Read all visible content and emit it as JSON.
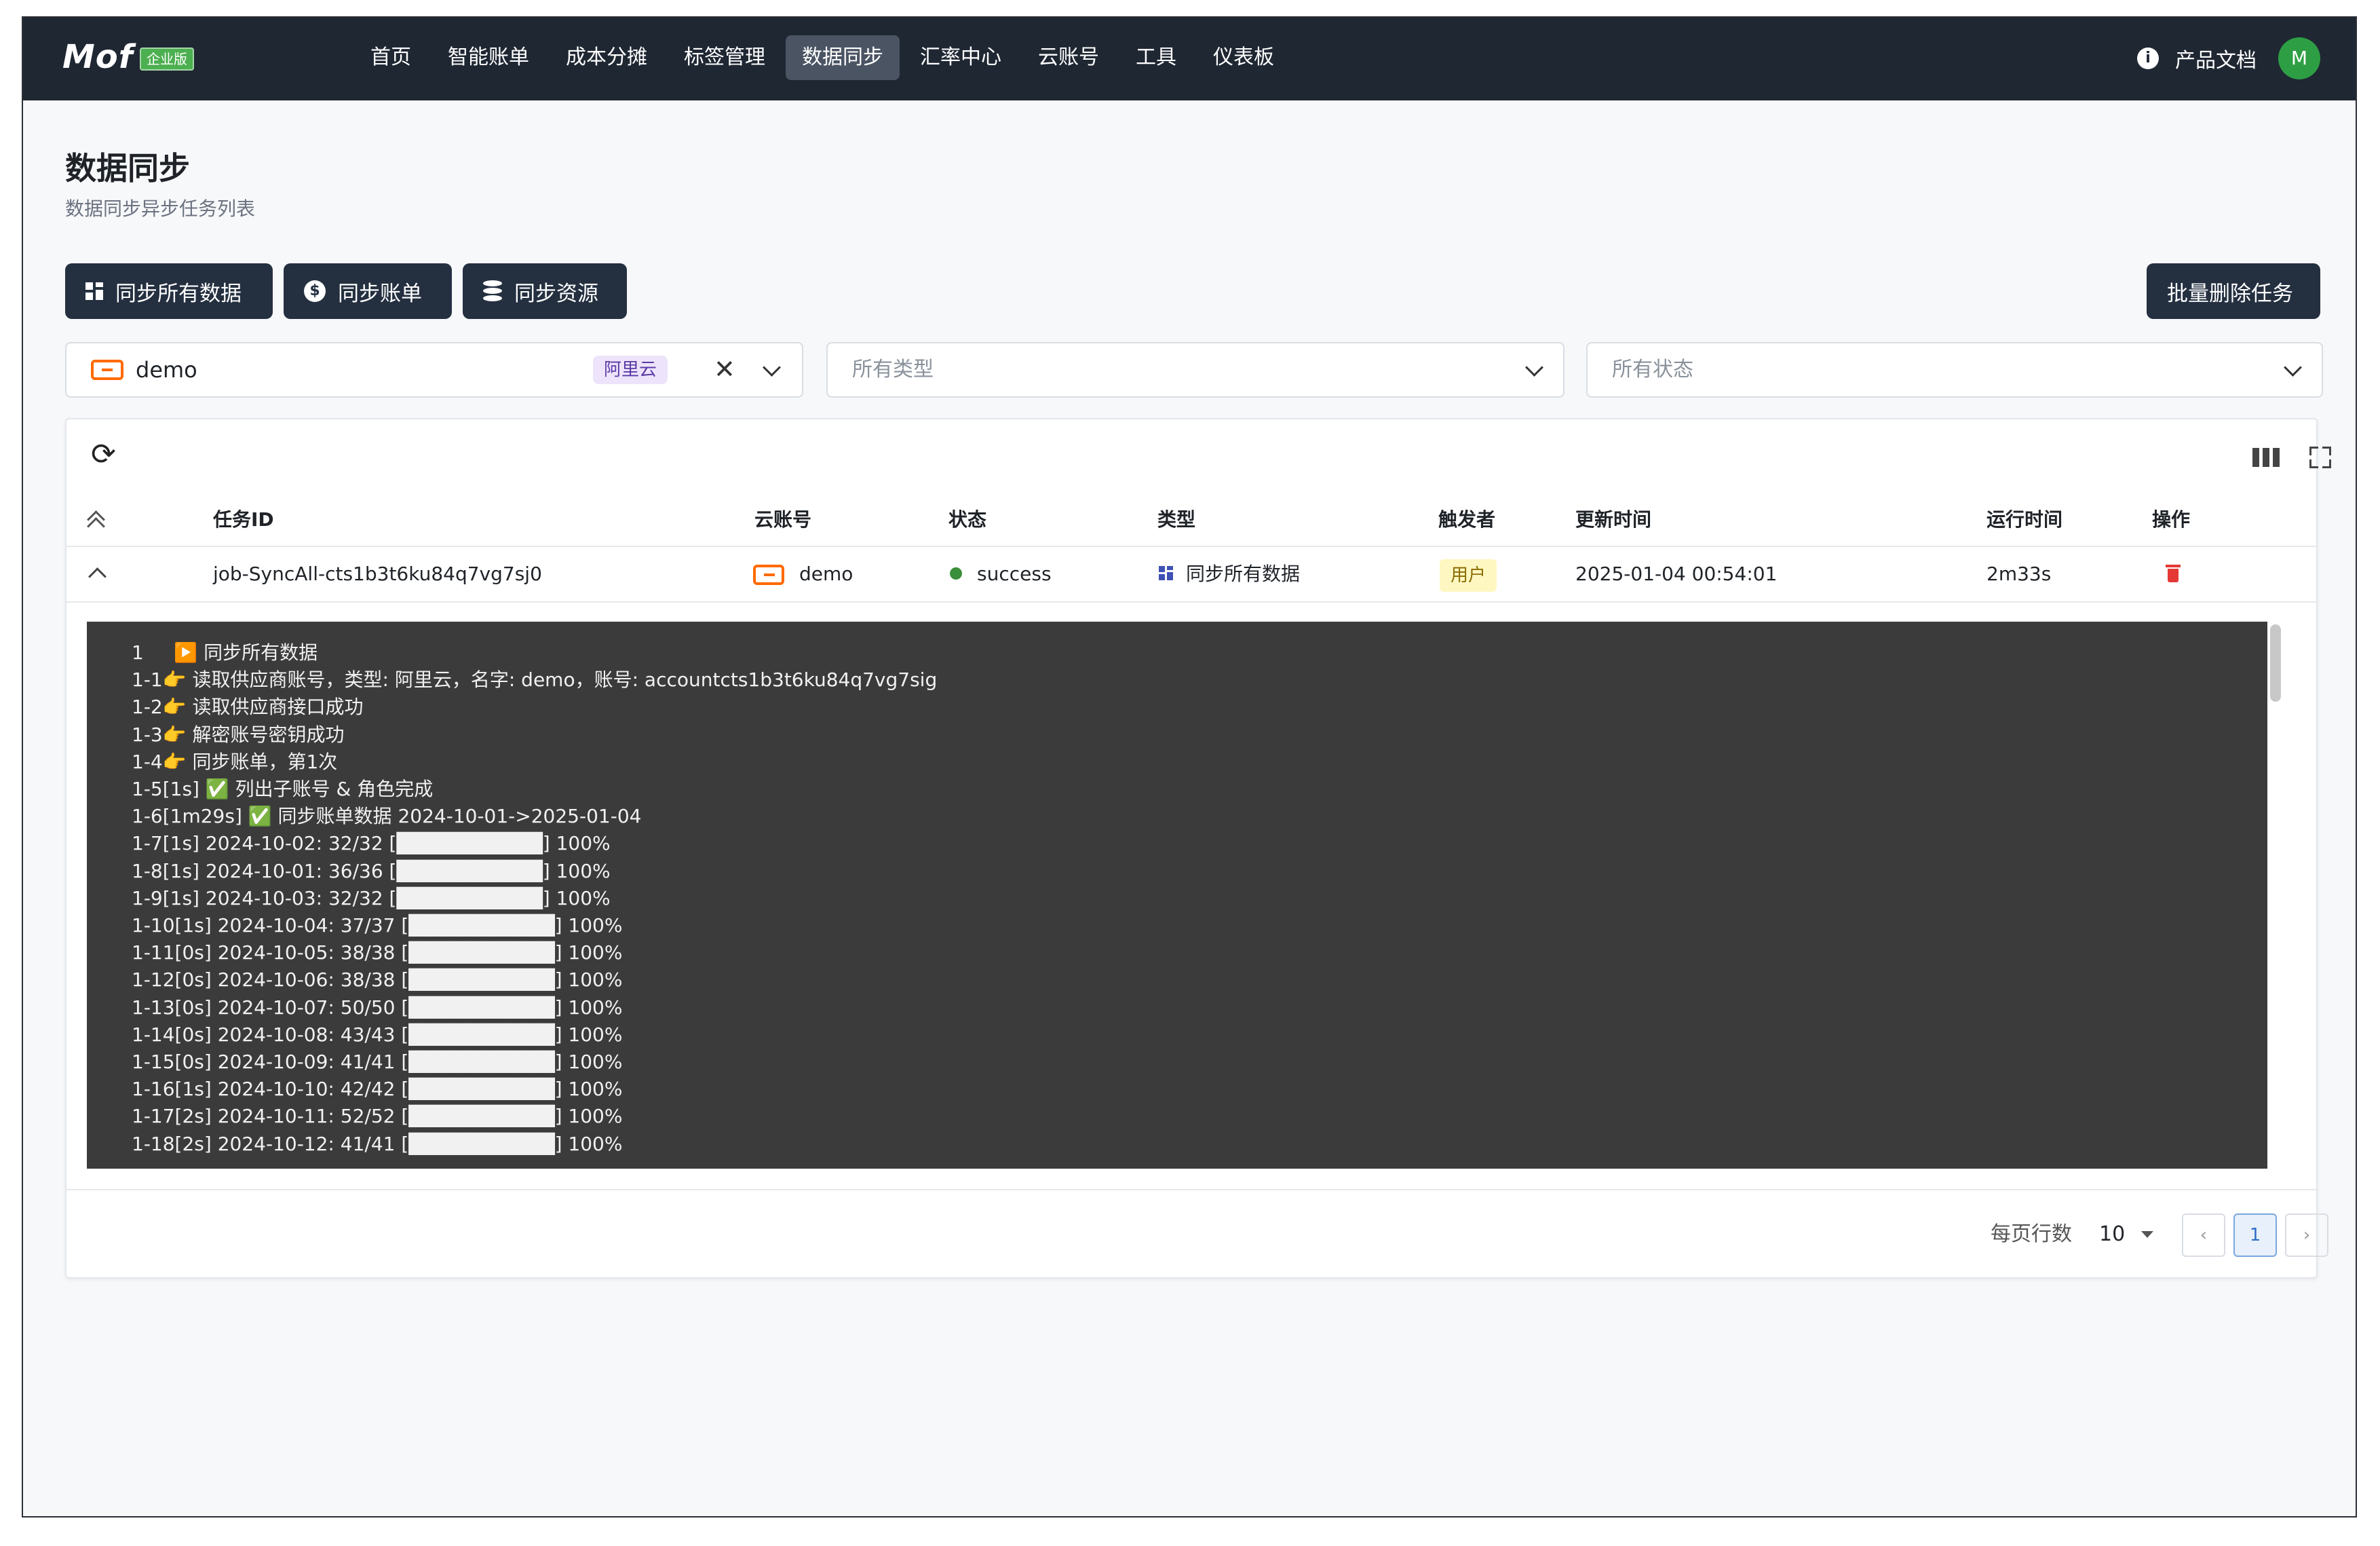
{
  "app": {
    "logo": "Mof",
    "edition": "企业版"
  },
  "nav": {
    "items": [
      "首页",
      "智能账单",
      "成本分摊",
      "标签管理",
      "数据同步",
      "汇率中心",
      "云账号",
      "工具",
      "仪表板"
    ],
    "active_index": 4,
    "doc_link": "产品文档",
    "avatar": "M"
  },
  "header": {
    "title": "数据同步",
    "subtitle": "数据同步异步任务列表"
  },
  "toolbar": {
    "sync_all": "同步所有数据",
    "sync_bill": "同步账单",
    "sync_resource": "同步资源",
    "batch_delete": "批量删除任务"
  },
  "filters": {
    "account": {
      "value": "demo",
      "provider_tag": "阿里云"
    },
    "type_placeholder": "所有类型",
    "status_placeholder": "所有状态"
  },
  "table": {
    "headers": [
      "任务ID",
      "云账号",
      "状态",
      "类型",
      "触发者",
      "更新时间",
      "运行时间",
      "操作"
    ],
    "rows": [
      {
        "task_id": "job-SyncAll-cts1b3t6ku84q7vg7sj0",
        "account": "demo",
        "status": "success",
        "type": "同步所有数据",
        "trigger": "用户",
        "updated": "2025-01-04 00:54:01",
        "duration": "2m33s"
      }
    ]
  },
  "log": [
    "1     ▶️ 同步所有数据",
    "1-1👉 读取供应商账号，类型: 阿里云，名字: demo，账号: accountcts1b3t6ku84q7vg7sig",
    "1-2👉 读取供应商接口成功",
    "1-3👉 解密账号密钥成功",
    "1-4👉 同步账单，第1次",
    "1-5[1s] ✅ 列出子账号 & 角色完成",
    "1-6[1m29s] ✅ 同步账单数据 2024-10-01->2025-01-04",
    "1-7[1s] 2024-10-02: 32/32 [██████████] 100%",
    "1-8[1s] 2024-10-01: 36/36 [██████████] 100%",
    "1-9[1s] 2024-10-03: 32/32 [██████████] 100%",
    "1-10[1s] 2024-10-04: 37/37 [██████████] 100%",
    "1-11[0s] 2024-10-05: 38/38 [██████████] 100%",
    "1-12[0s] 2024-10-06: 38/38 [██████████] 100%",
    "1-13[0s] 2024-10-07: 50/50 [██████████] 100%",
    "1-14[0s] 2024-10-08: 43/43 [██████████] 100%",
    "1-15[0s] 2024-10-09: 41/41 [██████████] 100%",
    "1-16[1s] 2024-10-10: 42/42 [██████████] 100%",
    "1-17[2s] 2024-10-11: 52/52 [██████████] 100%",
    "1-18[2s] 2024-10-12: 41/41 [██████████] 100%"
  ],
  "pagination": {
    "rows_label": "每页行数",
    "rows_per_page": "10",
    "current_page": "1"
  }
}
